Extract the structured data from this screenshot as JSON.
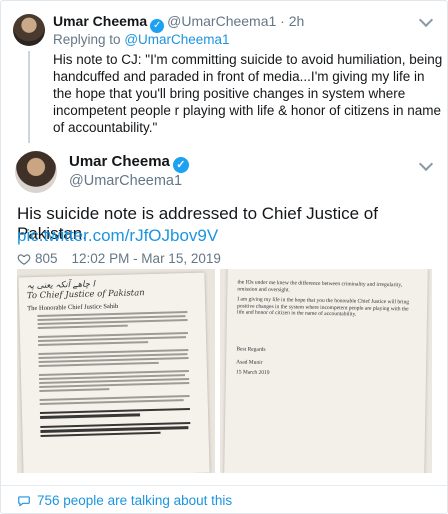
{
  "quoted": {
    "name": "Umar Cheema",
    "handle_time": "@UmarCheema1 · 2h",
    "replying_label": "Replying to",
    "replying_to": "@UmarCheema1",
    "text": "His note to CJ: \"I'm committing suicide to avoid humiliation, being handcuffed and paraded in front of media...I'm giving my life in the hope that you'll bring positive changes in system where incompetent people r playing with life & honor of citizens in name of accountability.\""
  },
  "tweet": {
    "name": "Umar Cheema",
    "handle": "@UmarCheema1",
    "text": "His suicide note is addressed to Chief Justice of Pakistan.",
    "link": "pic.twitter.com/rJfOJbov9V",
    "likes": "805",
    "timestamp": "12:02 PM - Mar 15, 2019"
  },
  "photo_left": {
    "handwriting_1": "ا چاھے آنکہ یعنی پہ",
    "handwriting_2": "To Chief Justice of Pakistan",
    "heading": "The Honorable Chief Justice Sahib"
  },
  "photo_right": {
    "p1": "the IOs under me knew the difference between criminality and irregularity, omission and oversight.",
    "p2": "I am giving my life in the hope that you the honorable Chief Justice will bring positive changes in the system where incompetent people are playing with the life and honor of citizen in the name of accountability.",
    "regards": "Best Regards",
    "signer": "Asad Munir",
    "date": "15 March 2019"
  },
  "footer": {
    "talking": "756 people are talking about this"
  },
  "colors": {
    "accent": "#1b95e0",
    "verified": "#1da1f2",
    "muted": "#657786"
  }
}
